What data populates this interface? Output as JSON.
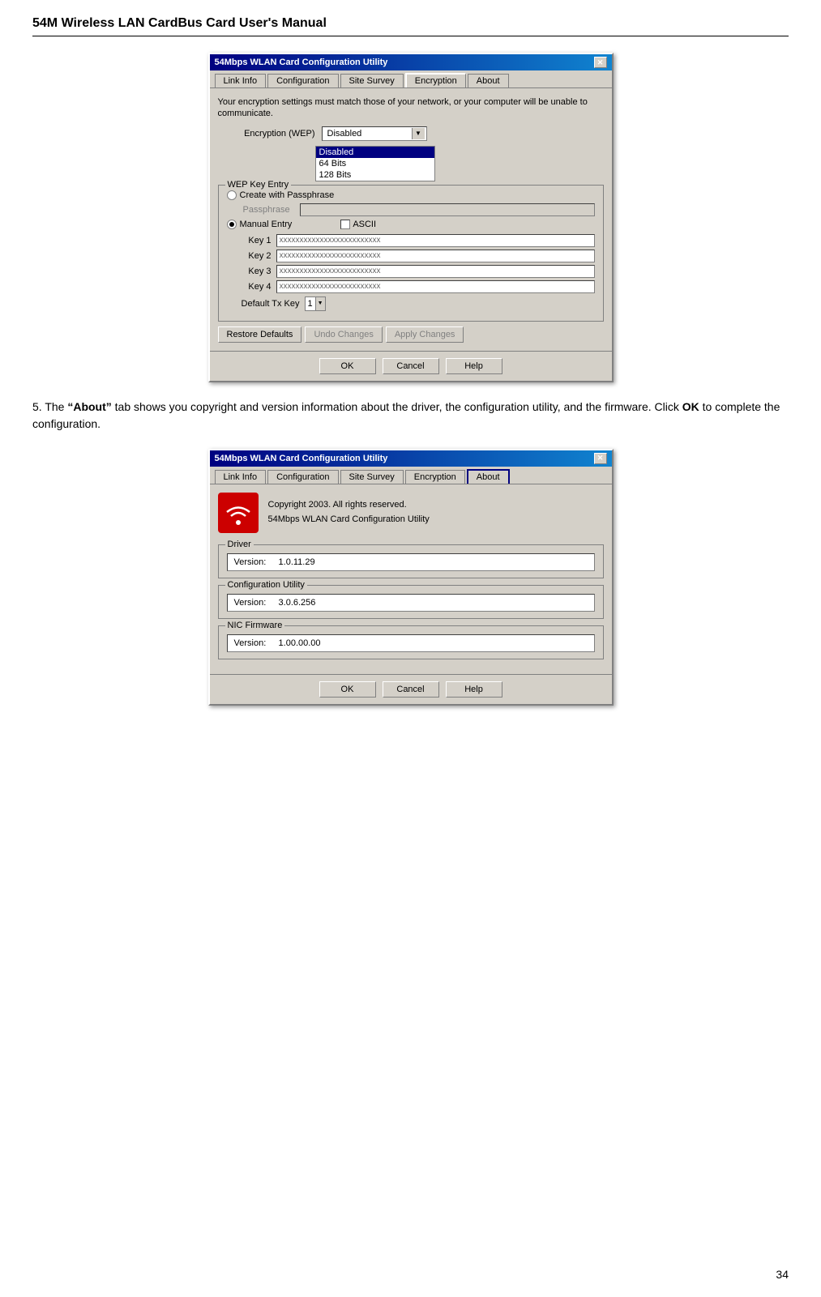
{
  "page": {
    "title": "54M Wireless LAN CardBus Card User's Manual",
    "page_number": "34"
  },
  "dialog1": {
    "title": "54Mbps WLAN Card Configuration Utility",
    "tabs": [
      "Link Info",
      "Configuration",
      "Site Survey",
      "Encryption",
      "About"
    ],
    "active_tab": "Encryption",
    "notice": "Your encryption settings must match those of your network, or your computer will be unable to communicate.",
    "encryption_label": "Encryption (WEP)",
    "encryption_value": "Disabled",
    "dropdown_options": [
      "Disabled",
      "64 Bits",
      "128 Bits"
    ],
    "dropdown_selected": "Disabled",
    "wep_group_title": "WEP Key Entry",
    "create_passphrase": "Create with Passphrase",
    "passphrase_label": "Passphrase",
    "manual_entry": "Manual Entry",
    "ascii_label": "ASCII",
    "keys": [
      {
        "label": "Key 1",
        "value": "xxxxxxxxxxxxxxxxxxxxxxxxx"
      },
      {
        "label": "Key 2",
        "value": "xxxxxxxxxxxxxxxxxxxxxxxxx"
      },
      {
        "label": "Key 3",
        "value": "xxxxxxxxxxxxxxxxxxxxxxxxx"
      },
      {
        "label": "Key 4",
        "value": "xxxxxxxxxxxxxxxxxxxxxxxxx"
      }
    ],
    "default_tx_label": "Default Tx Key",
    "default_tx_value": "1",
    "btn_restore": "Restore Defaults",
    "btn_undo": "Undo Changes",
    "btn_apply": "Apply Changes",
    "btn_ok": "OK",
    "btn_cancel": "Cancel",
    "btn_help": "Help",
    "close_btn": "✕"
  },
  "section5": {
    "text_before": "5.  The ",
    "bold_text": "“About”",
    "text_after": " tab shows you copyright and version information about the driver, the configuration utility, and the firmware. Click ",
    "bold_ok": "OK",
    "text_end": " to complete the configuration."
  },
  "dialog2": {
    "title": "54Mbps WLAN Card Configuration Utility",
    "tabs": [
      "Link Info",
      "Configuration",
      "Site Survey",
      "Encryption",
      "About"
    ],
    "active_tab": "About",
    "copyright_line1": "Copyright 2003. All rights reserved.",
    "copyright_line2": "54Mbps WLAN Card Configuration Utility",
    "driver_group": "Driver",
    "driver_version_label": "Version:",
    "driver_version_value": "1.0.11.29",
    "config_group": "Configuration Utility",
    "config_version_label": "Version:",
    "config_version_value": "3.0.6.256",
    "nic_group": "NIC Firmware",
    "nic_version_label": "Version:",
    "nic_version_value": "1.00.00.00",
    "btn_ok": "OK",
    "btn_cancel": "Cancel",
    "btn_help": "Help",
    "close_btn": "✕"
  }
}
